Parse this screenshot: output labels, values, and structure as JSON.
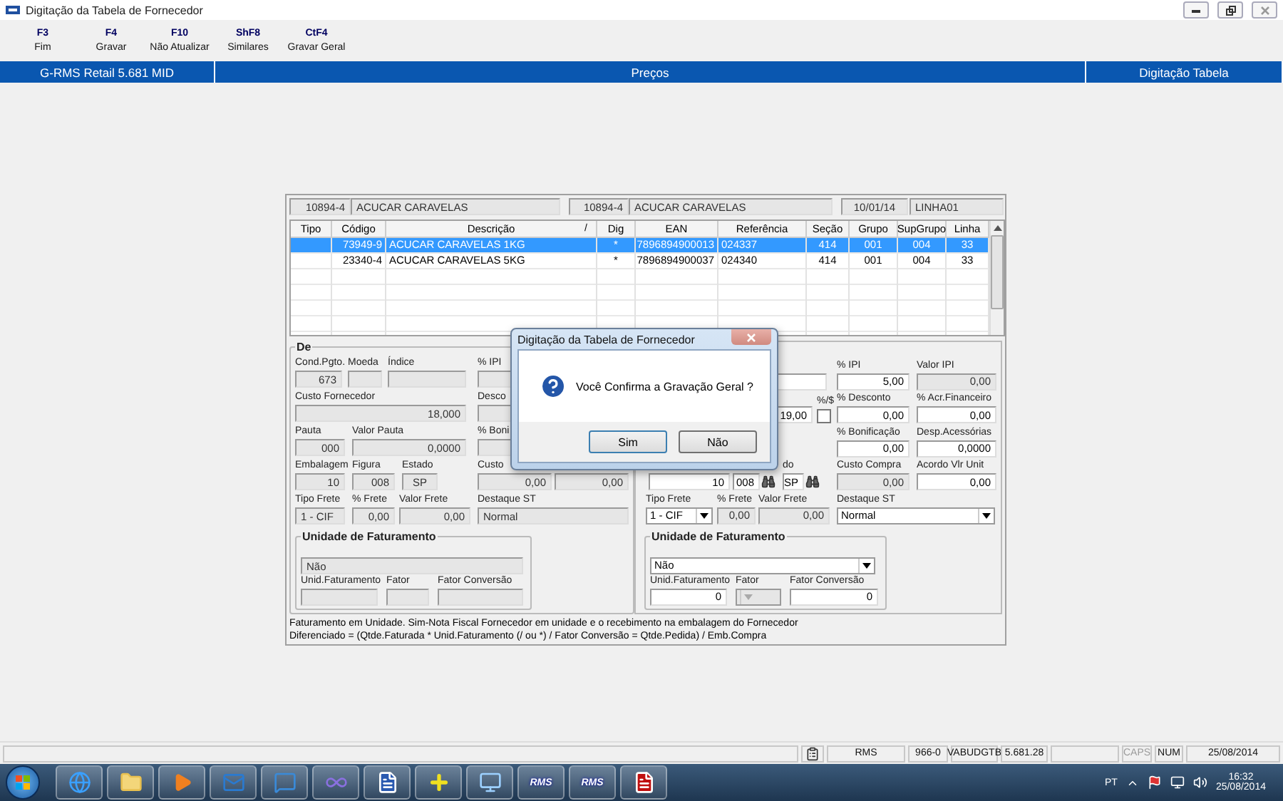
{
  "window": {
    "title": "Digitação da Tabela de Fornecedor"
  },
  "toolbar": [
    {
      "key": "F3",
      "label": "Fim"
    },
    {
      "key": "F4",
      "label": "Gravar"
    },
    {
      "key": "F10",
      "label": "Não Atualizar"
    },
    {
      "key": "ShF8",
      "label": "Similares"
    },
    {
      "key": "CtF4",
      "label": "Gravar Geral"
    }
  ],
  "banner": {
    "system": "G-RMS Retail 5.681 MID",
    "module": "Preços",
    "screen": "Digitação Tabela"
  },
  "header": [
    {
      "kind": "number",
      "value": "10894-4"
    },
    {
      "kind": "text",
      "value": "ACUCAR CARAVELAS"
    },
    {
      "kind": "number",
      "value": "10894-4"
    },
    {
      "kind": "text",
      "value": "ACUCAR CARAVELAS"
    },
    {
      "kind": "center",
      "value": "10/01/14"
    },
    {
      "kind": "text",
      "value": "LINHA01"
    }
  ],
  "table": {
    "columns": [
      {
        "label": "Tipo"
      },
      {
        "label": "Código"
      },
      {
        "label": "Descrição",
        "marker": "/"
      },
      {
        "label": "Dig"
      },
      {
        "label": "EAN"
      },
      {
        "label": "Referência"
      },
      {
        "label": "Seção"
      },
      {
        "label": "Grupo"
      },
      {
        "label": "SupGrupo"
      },
      {
        "label": "Linha"
      }
    ],
    "rows": [
      {
        "selected": true,
        "codigo": "73949-9",
        "descricao": "ACUCAR CARAVELAS 1KG",
        "dig": "*",
        "ean": "7896894900013",
        "referencia": "024337",
        "secao": "414",
        "grupo": "001",
        "supgrupo": "004",
        "linha": "33"
      },
      {
        "selected": false,
        "codigo": "23340-4",
        "descricao": "ACUCAR CARAVELAS 5KG",
        "dig": "*",
        "ean": "7896894900037",
        "referencia": "024340",
        "secao": "414",
        "grupo": "001",
        "supgrupo": "004",
        "linha": "33"
      }
    ]
  },
  "left_panel": {
    "legend": "De",
    "rows": [
      {
        "main": [
          {
            "kind": "number",
            "label": "Cond.Pgto.",
            "value": "673",
            "disabled": true
          },
          {
            "kind": "number",
            "label": "Moeda",
            "disabled": true
          },
          {
            "kind": "number",
            "label": "Índice",
            "disabled": true
          }
        ],
        "side": [
          {
            "kind": "number",
            "label": "% IPI",
            "disabled": true
          }
        ]
      },
      {
        "main": [
          {
            "kind": "number",
            "label": "Custo Fornecedor",
            "value": "18,000",
            "disabled": true
          }
        ],
        "side": [
          {
            "kind": "number",
            "label": "Desco",
            "disabled": true
          }
        ]
      },
      {
        "main": [
          {
            "kind": "number",
            "label": "Pauta",
            "value": "000",
            "disabled": true
          },
          {
            "kind": "number",
            "label": "Valor Pauta",
            "value": "0,0000",
            "disabled": true
          }
        ],
        "side": [
          {
            "kind": "number",
            "label": "% Boni",
            "disabled": true
          }
        ]
      },
      {
        "main": [
          {
            "kind": "number",
            "label": "Embalagem",
            "value": "10",
            "disabled": true
          },
          {
            "kind": "number",
            "label": "Figura",
            "value": "008",
            "disabled": true
          },
          {
            "kind": "center",
            "label": "Estado",
            "value": "SP",
            "disabled": true
          }
        ],
        "side": [
          {
            "kind": "number",
            "label": "Custo",
            "value": "0,00",
            "disabled": true
          },
          {
            "kind": "number",
            "value": "0,00",
            "disabled": true
          }
        ]
      },
      {
        "main": [
          {
            "kind": "text",
            "label": "Tipo Frete",
            "value": "1 - CIF",
            "disabled": true
          },
          {
            "kind": "number",
            "label": "% Frete",
            "value": "0,00",
            "disabled": true
          },
          {
            "kind": "number",
            "label": "Valor Frete",
            "value": "0,00",
            "disabled": true
          }
        ],
        "side": [
          {
            "kind": "text",
            "label": "Destaque ST",
            "value": "Normal",
            "disabled": true
          }
        ]
      }
    ],
    "unidade": {
      "legend": "Unidade de Faturamento",
      "rows": [
        [
          {
            "kind": "text",
            "value": "Não",
            "disabled": true
          }
        ],
        [
          {
            "kind": "number",
            "label": "Unid.Faturamento",
            "disabled": true
          },
          {
            "kind": "number",
            "label": "Fator",
            "disabled": true
          },
          {
            "kind": "number",
            "label": "Fator Conversão",
            "disabled": true
          }
        ]
      ]
    }
  },
  "right_panel": {
    "rows": [
      {
        "main": [
          {
            "kind": "number",
            "disabled": false
          }
        ],
        "side": [
          {
            "kind": "number",
            "label": "% IPI",
            "value": "5,00",
            "disabled": false
          },
          {
            "kind": "number",
            "label": "Valor IPI",
            "value": "0,00",
            "disabled": true
          }
        ]
      },
      {
        "main": [
          {
            "kind": "number",
            "value": "19,00",
            "disabled": false
          },
          {
            "kind": "checkbox",
            "label": "%/$",
            "checked": false
          }
        ],
        "side": [
          {
            "kind": "number",
            "label": "% Desconto",
            "value": "0,00",
            "disabled": false
          },
          {
            "kind": "number",
            "label": "% Acr.Financeiro",
            "value": "0,00",
            "disabled": false
          }
        ]
      },
      {
        "side": [
          {
            "kind": "number",
            "label": "% Bonificação",
            "value": "0,00",
            "disabled": false
          },
          {
            "kind": "number",
            "label": "Desp.Acessórias",
            "value": "0,0000",
            "disabled": false
          }
        ]
      },
      {
        "main": [
          {
            "kind": "number",
            "value": "10",
            "disabled": false
          },
          {
            "kind": "lookup",
            "value": "008",
            "disabled": false
          },
          {
            "kind": "lookup",
            "label": "do",
            "value": "SP",
            "disabled": false
          }
        ],
        "side": [
          {
            "kind": "number",
            "label": "Custo Compra",
            "value": "0,00",
            "disabled": true
          },
          {
            "kind": "number",
            "label": "Acordo Vlr Unit",
            "value": "0,00",
            "disabled": false
          }
        ]
      },
      {
        "main": [
          {
            "kind": "select",
            "label": "Tipo Frete",
            "value": "1 - CIF",
            "disabled": false
          },
          {
            "kind": "number",
            "label": "% Frete",
            "value": "0,00",
            "disabled": true
          },
          {
            "kind": "number",
            "label": "Valor Frete",
            "value": "0,00",
            "disabled": true
          }
        ],
        "side": [
          {
            "kind": "select",
            "label": "Destaque ST",
            "value": "Normal",
            "disabled": false
          }
        ]
      }
    ],
    "unidade": {
      "legend": "Unidade de Faturamento",
      "rows": [
        [
          {
            "kind": "select",
            "value": "Não",
            "disabled": false
          }
        ],
        [
          {
            "kind": "number",
            "label": "Unid.Faturamento",
            "value": "0",
            "disabled": false
          },
          {
            "kind": "select",
            "label": "Fator",
            "disabled": true
          },
          {
            "kind": "number",
            "label": "Fator Conversão",
            "value": "0",
            "disabled": false
          }
        ]
      ]
    }
  },
  "notes": [
    "Faturamento em Unidade. Sim-Nota Fiscal Fornecedor em unidade e o recebimento na embalagem do Fornecedor",
    "Diferenciado = (Qtde.Faturada * Unid.Faturamento (/ ou *) / Fator Conversão  = Qtde.Pedida) / Emb.Compra"
  ],
  "dialog": {
    "title": "Digitação da Tabela de Fornecedor",
    "message": "Você Confirma a Gravação Geral ?",
    "buttons": [
      {
        "label": "Sim",
        "selected": true
      },
      {
        "label": "Não",
        "selected": false
      }
    ]
  },
  "status_bar": [
    {
      "kind": "blank"
    },
    {
      "kind": "clipboard"
    },
    {
      "kind": "text",
      "text": "RMS",
      "disabled": false
    },
    {
      "kind": "text",
      "text": "966-0",
      "disabled": false
    },
    {
      "kind": "text",
      "text": "VABUDGTB",
      "disabled": false
    },
    {
      "kind": "text",
      "text": "5.681.28",
      "disabled": false
    },
    {
      "kind": "blank"
    },
    {
      "kind": "text",
      "text": "CAPS",
      "disabled": true
    },
    {
      "kind": "text",
      "text": "NUM",
      "disabled": false
    },
    {
      "kind": "text",
      "text": "25/08/2014",
      "disabled": false
    }
  ],
  "taskbar": {
    "apps": [
      {
        "kind": "browser"
      },
      {
        "kind": "folder"
      },
      {
        "kind": "media"
      },
      {
        "kind": "mail"
      },
      {
        "kind": "chat"
      },
      {
        "kind": "loop"
      },
      {
        "kind": "document"
      },
      {
        "kind": "add"
      },
      {
        "kind": "remote"
      },
      {
        "kind": "rms",
        "label": "RMS"
      },
      {
        "kind": "rms",
        "label": "RMS"
      },
      {
        "kind": "pdf"
      }
    ],
    "language": "PT",
    "time": "16:32",
    "date": "25/08/2014"
  }
}
